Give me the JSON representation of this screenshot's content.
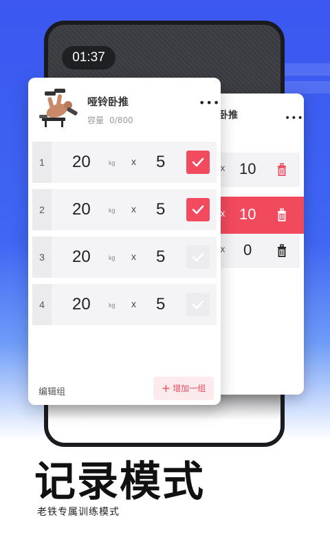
{
  "timer": "01:37",
  "exercise": {
    "name": "哑铃卧推",
    "capacity_label": "容量",
    "capacity_value": "0/800",
    "more": "•••"
  },
  "sets": [
    {
      "index": "1",
      "weight": "20",
      "unit": "kg",
      "times": "x",
      "reps": "5",
      "done": true
    },
    {
      "index": "2",
      "weight": "20",
      "unit": "kg",
      "times": "x",
      "reps": "5",
      "done": true
    },
    {
      "index": "3",
      "weight": "20",
      "unit": "kg",
      "times": "x",
      "reps": "5",
      "done": false
    },
    {
      "index": "4",
      "weight": "20",
      "unit": "kg",
      "times": "x",
      "reps": "5",
      "done": false
    }
  ],
  "actions": {
    "edit_group": "编辑组",
    "add_group_plus": "+",
    "add_group": "增加一组"
  },
  "back_card": {
    "title": "卧推",
    "more": "•••",
    "rows": [
      {
        "times": "x",
        "reps": "10",
        "active": false
      },
      {
        "times": "x",
        "reps": "10",
        "active": true
      },
      {
        "times": "x",
        "reps": "0",
        "active": false
      }
    ]
  },
  "headline": "记录模式",
  "subline": "老铁专属训练模式",
  "colors": {
    "accent": "#f24a5f",
    "background_blue": "#3b57f0",
    "check_off": "#ececef"
  }
}
